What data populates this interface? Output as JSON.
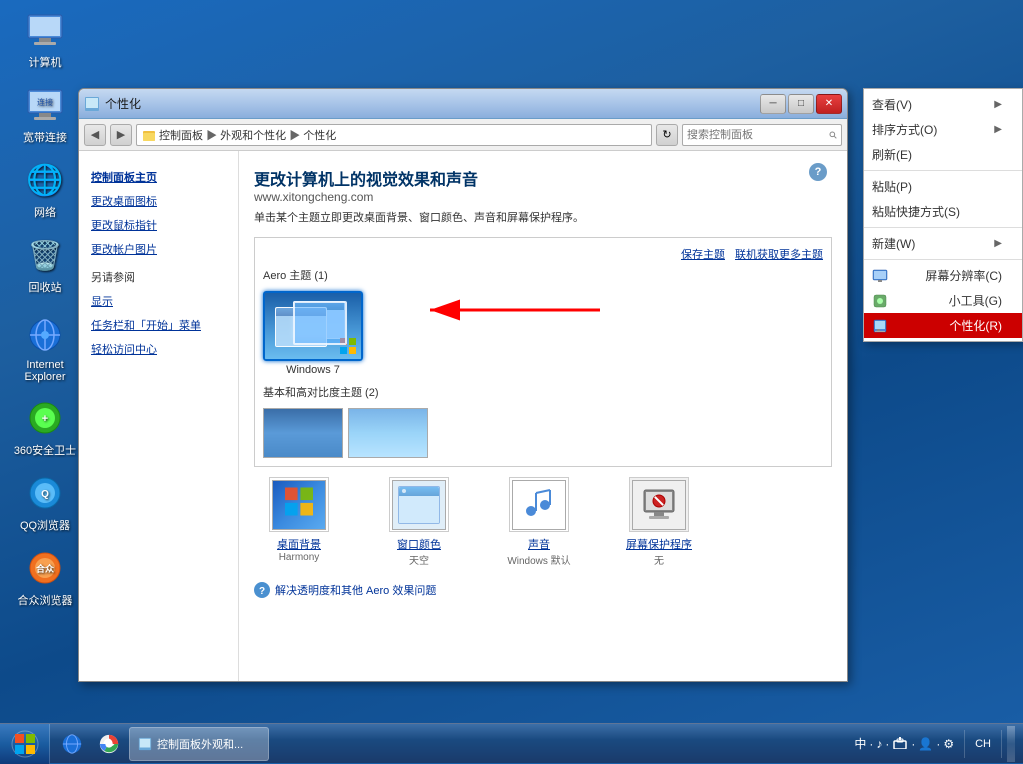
{
  "desktop": {
    "icons": [
      {
        "id": "computer",
        "label": "计算机",
        "emoji": "🖥️"
      },
      {
        "id": "broadband",
        "label": "宽带连接",
        "emoji": "📡"
      },
      {
        "id": "network",
        "label": "网络",
        "emoji": "🌐"
      },
      {
        "id": "recycle",
        "label": "回收站",
        "emoji": "🗑️"
      },
      {
        "id": "ie",
        "label": "Internet\nExplorer",
        "emoji": "🌐"
      },
      {
        "id": "360",
        "label": "360安全卫士",
        "emoji": "🛡️"
      },
      {
        "id": "qq",
        "label": "QQ浏览器",
        "emoji": "🦊"
      },
      {
        "id": "hao",
        "label": "合众浏览器",
        "emoji": "🌐"
      }
    ]
  },
  "taskbar": {
    "start_label": "⊞",
    "apps": [
      {
        "id": "controlpanel",
        "label": "控制面板外观和...",
        "active": true
      }
    ],
    "tray": "中  ♪  ⊞  ⊟  ▲  ⚙",
    "clock": "CH"
  },
  "window": {
    "title": "个性化",
    "controls": {
      "minimize": "─",
      "maximize": "□",
      "close": "✕"
    },
    "address": {
      "back": "◀",
      "forward": "▶",
      "breadcrumb": "控制面板 ▶ 外观和个性化 ▶ 个性化",
      "refresh": "↻",
      "search_placeholder": "搜索控制面板"
    },
    "sidebar": {
      "main_link": "控制面板主页",
      "links": [
        "更改桌面图标",
        "更改鼠标指针",
        "更改帐户图片"
      ],
      "also_label": "另请参阅",
      "also_links": [
        "显示",
        "任务栏和「开始」菜单",
        "轻松访问中心"
      ]
    },
    "main": {
      "title": "更改计算机上的视觉效果和声音",
      "url": "www.xitongcheng.com",
      "desc": "单击某个主题立即更改桌面背景、窗口颜色、声音和屏幕保护程序。",
      "save_theme": "保存主题",
      "get_more": "联机获取更多主题",
      "aero_label": "Aero 主题 (1)",
      "themes": [
        {
          "id": "win7",
          "name": "Windows 7",
          "selected": true
        }
      ],
      "basic_label": "基本和高对比度主题 (2)",
      "settings": [
        {
          "id": "wallpaper",
          "label": "桌面背景",
          "sublabel": "Harmony"
        },
        {
          "id": "window-color",
          "label": "窗口颜色",
          "sublabel": "天空"
        },
        {
          "id": "sound",
          "label": "声音",
          "sublabel": "Windows 默认"
        },
        {
          "id": "screensaver",
          "label": "屏幕保护程序",
          "sublabel": "无"
        }
      ],
      "resolve_link": "解决透明度和其他 Aero 效果问题"
    }
  },
  "context_menu": {
    "items": [
      {
        "id": "view",
        "label": "查看(V)",
        "has_arrow": true
      },
      {
        "id": "sort",
        "label": "排序方式(O)",
        "has_arrow": true
      },
      {
        "id": "refresh",
        "label": "刷新(E)",
        "has_arrow": false
      },
      {
        "separator": true
      },
      {
        "id": "paste",
        "label": "粘贴(P)",
        "has_arrow": false
      },
      {
        "id": "paste-shortcut",
        "label": "粘贴快捷方式(S)",
        "has_arrow": false
      },
      {
        "separator": true
      },
      {
        "id": "new",
        "label": "新建(W)",
        "has_arrow": true
      },
      {
        "separator": true
      },
      {
        "id": "resolution",
        "label": "屏幕分辨率(C)",
        "has_icon": true
      },
      {
        "id": "gadgets",
        "label": "小工具(G)",
        "has_icon": true
      },
      {
        "id": "personalize",
        "label": "个性化(R)",
        "highlighted": true,
        "has_icon": true
      }
    ]
  }
}
